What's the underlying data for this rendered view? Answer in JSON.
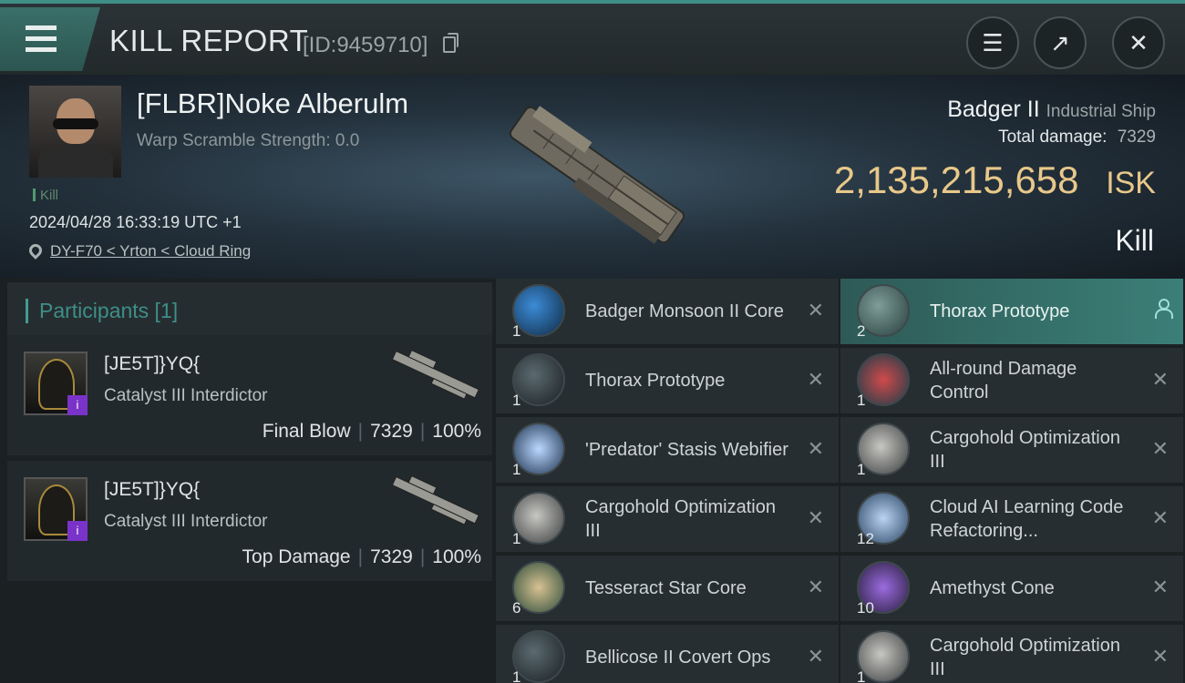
{
  "header": {
    "title": "KILL REPORT",
    "report_id": "[ID:9459710]",
    "icons": [
      "menu-icon",
      "clipboard-icon",
      "share-icon",
      "close-icon"
    ]
  },
  "victim": {
    "name": "[FLBR]Noke Alberulm",
    "warp_scramble": "Warp Scramble Strength: 0.0",
    "tag": "Kill",
    "timestamp": "2024/04/28 16:33:19 UTC +1",
    "location": "DY-F70 < Yrton < Cloud Ring",
    "ship_name": "Badger II",
    "ship_class": "Industrial Ship",
    "total_damage_label": "Total damage:",
    "total_damage": "7329",
    "isk_value": "2,135,215,658",
    "isk_unit": "ISK",
    "result": "Kill",
    "colors": {
      "accent": "#3f9c93",
      "isk": "#e8c88a"
    }
  },
  "participants": {
    "title": "Participants [1]",
    "list": [
      {
        "name": "[JE5T]}YQ{",
        "ship": "Catalyst III Interdictor",
        "role": "Final Blow",
        "damage": "7329",
        "percent": "100%"
      },
      {
        "name": "[JE5T]}YQ{",
        "ship": "Catalyst III Interdictor",
        "role": "Top Damage",
        "damage": "7329",
        "percent": "100%"
      }
    ]
  },
  "items": {
    "left": [
      {
        "name": "Badger Monsoon II Core",
        "qty": "1",
        "icon": "core-icon"
      },
      {
        "name": "Thorax Prototype",
        "qty": "1",
        "icon": "ship-blueprint-icon"
      },
      {
        "name": "'Predator' Stasis Webifier",
        "qty": "1",
        "icon": "webifier-icon"
      },
      {
        "name": "Cargohold Optimization III",
        "qty": "1",
        "icon": "cargohold-rig-icon"
      },
      {
        "name": "Tesseract Star Core",
        "qty": "6",
        "icon": "star-core-icon"
      },
      {
        "name": "Bellicose II Covert Ops",
        "qty": "1",
        "icon": "ship-blueprint-icon"
      }
    ],
    "right": [
      {
        "name": "Thorax Prototype",
        "qty": "2",
        "icon": "ship-blueprint-icon",
        "highlight": true
      },
      {
        "name": "All-round Damage Control",
        "qty": "1",
        "icon": "damage-control-icon"
      },
      {
        "name": "Cargohold Optimization III",
        "qty": "1",
        "icon": "cargohold-rig-icon"
      },
      {
        "name": "Cloud AI Learning Code Refactoring...",
        "qty": "12",
        "icon": "ai-core-icon"
      },
      {
        "name": "Amethyst Cone",
        "qty": "10",
        "icon": "amethyst-icon"
      },
      {
        "name": "Cargohold Optimization III",
        "qty": "1",
        "icon": "cargohold-rig-icon"
      }
    ]
  }
}
